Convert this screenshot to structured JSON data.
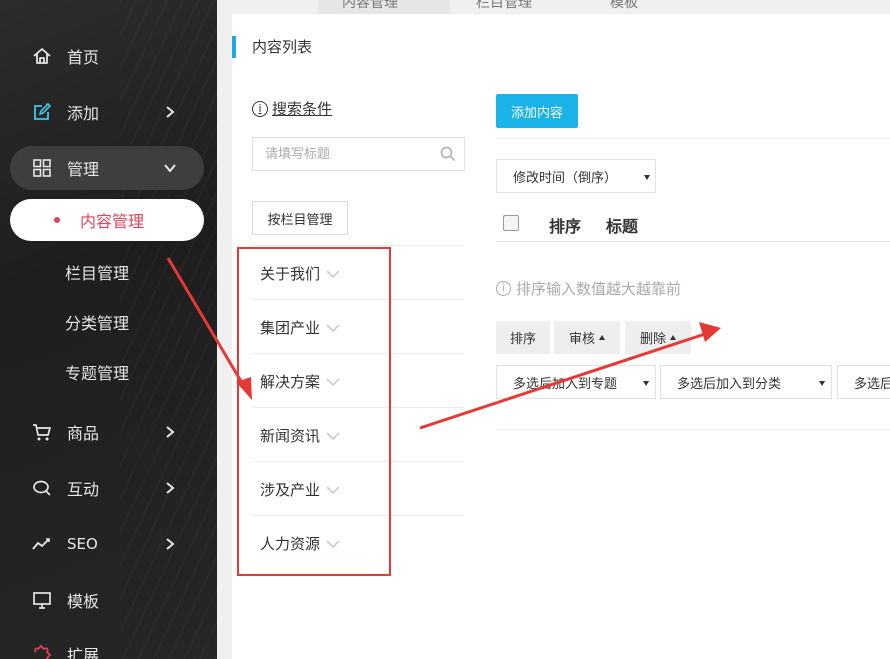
{
  "top_tabs": [
    "内容管理",
    "栏目管理",
    "模板"
  ],
  "section_title": "内容列表",
  "sidebar": {
    "items": [
      {
        "label": "首页",
        "icon": "home-icon"
      },
      {
        "label": "添加",
        "icon": "edit-icon"
      },
      {
        "label": "管理",
        "icon": "grid-icon"
      },
      {
        "label": "商品",
        "icon": "cart-icon"
      },
      {
        "label": "互动",
        "icon": "chat-icon"
      },
      {
        "label": "SEO",
        "icon": "trend-icon"
      },
      {
        "label": "模板",
        "icon": "monitor-icon"
      },
      {
        "label": "扩展",
        "icon": "extension-icon"
      }
    ],
    "sub_items": [
      "内容管理",
      "栏目管理",
      "分类管理",
      "专题管理"
    ],
    "active_color": "#e0435a"
  },
  "search": {
    "heading": "搜索条件",
    "placeholder": "请填写标题",
    "column_button": "按栏目管理"
  },
  "categories": [
    "关于我们",
    "集团产业",
    "解决方案",
    "新闻资讯",
    "涉及产业",
    "人力资源"
  ],
  "content": {
    "add_button": "添加内容",
    "sort_select": "修改时间（倒序）",
    "columns": [
      "排序",
      "标题"
    ],
    "hint": "排序输入数值越大越靠前",
    "action_buttons": [
      "排序",
      "审核",
      "删除"
    ],
    "multi_selects": [
      "多选后加入到专题",
      "多选后加入到分类",
      "多选后"
    ]
  },
  "colors": {
    "accent": "#1ab3e8",
    "annotation": "#e53935"
  }
}
